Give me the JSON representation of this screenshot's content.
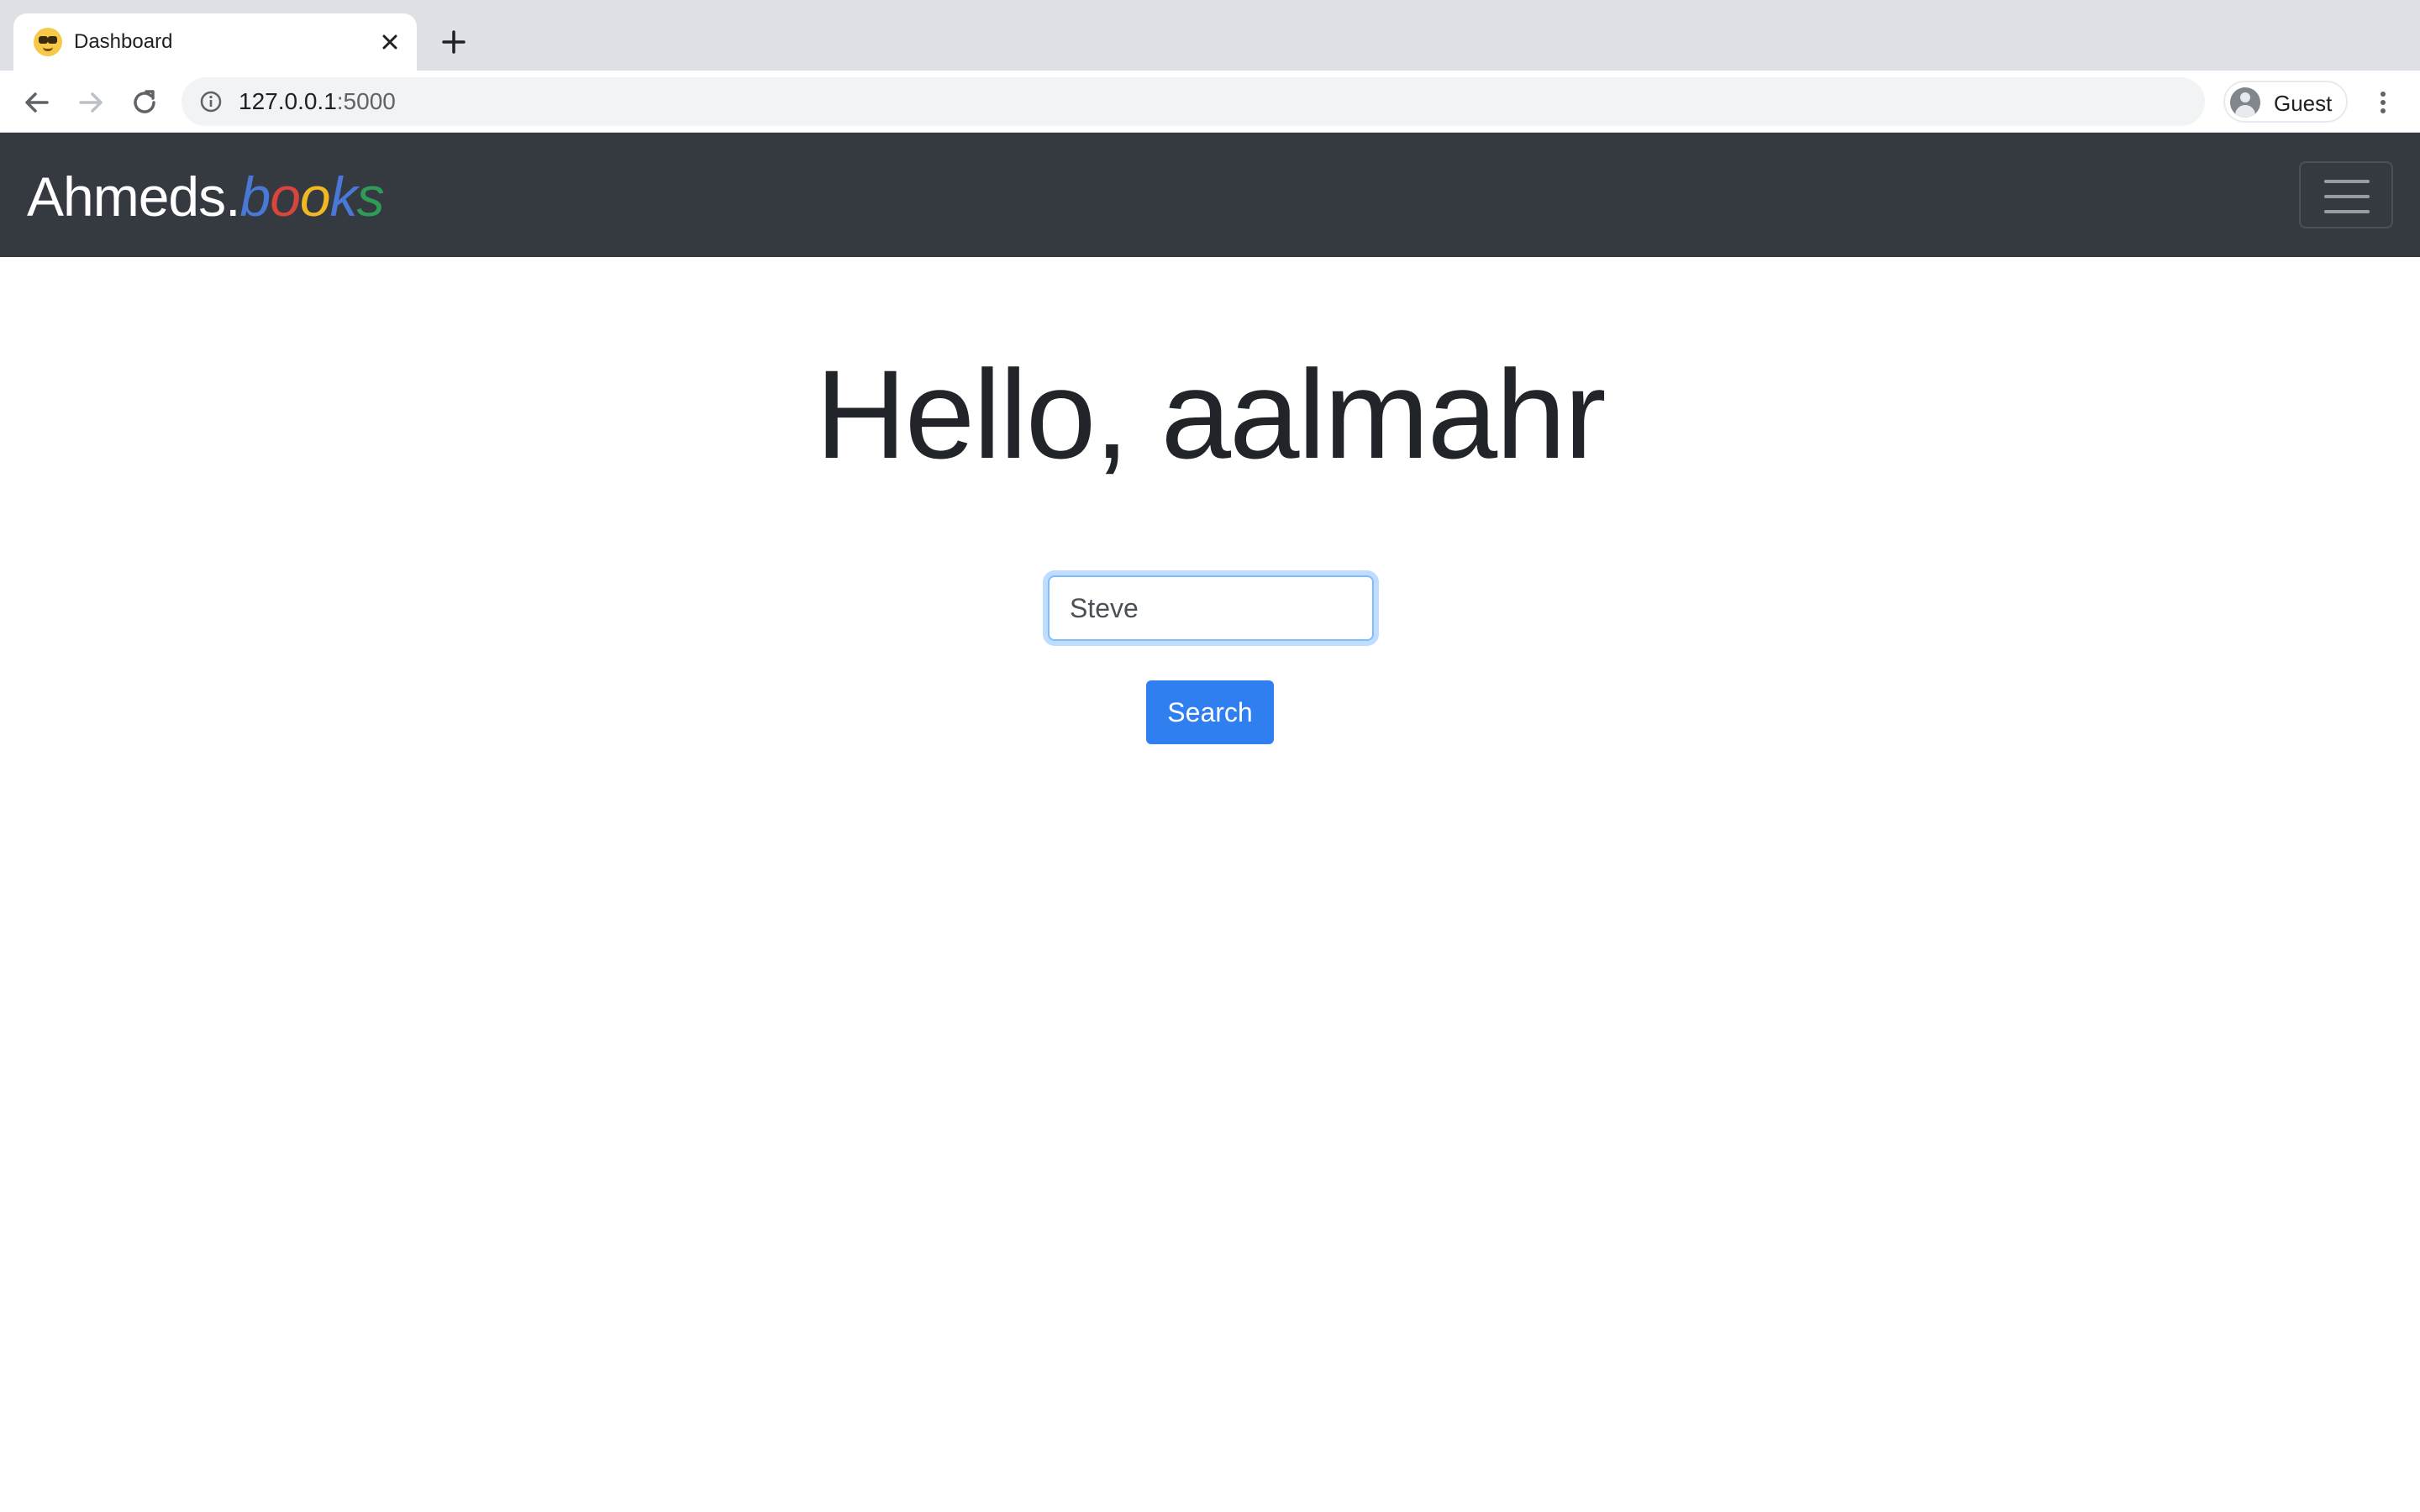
{
  "browser": {
    "tab": {
      "title": "Dashboard",
      "favicon": "nerd-face-emoji-icon"
    },
    "new_tab_icon": "plus-icon",
    "nav": {
      "back_icon": "arrow-left-icon",
      "forward_icon": "arrow-right-icon",
      "reload_icon": "reload-icon"
    },
    "address": {
      "host": "127.0.0.1",
      "port": ":5000",
      "info_icon": "info-circle-icon"
    },
    "profile": {
      "label": "Guest",
      "avatar_icon": "person-icon"
    },
    "menu_icon": "more-vertical-icon"
  },
  "navbar": {
    "brand_prefix": "Ahmeds.",
    "brand_letters": [
      {
        "char": "b",
        "color": "#4a78d6"
      },
      {
        "char": "o",
        "color": "#d9453d"
      },
      {
        "char": "o",
        "color": "#f2b824"
      },
      {
        "char": "k",
        "color": "#4a78d6"
      },
      {
        "char": "s",
        "color": "#2e9c57"
      }
    ],
    "background": "#343a40",
    "toggler_icon": "hamburger-menu-icon"
  },
  "main": {
    "greeting": "Hello, aalmahr",
    "search": {
      "value": "Steve",
      "placeholder": ""
    },
    "search_button_label": "Search",
    "accent": "#2f7ff0"
  }
}
